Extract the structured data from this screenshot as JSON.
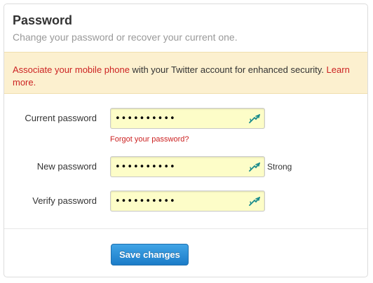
{
  "header": {
    "title": "Password",
    "subtitle": "Change your password or recover your current one."
  },
  "alert": {
    "link_text": "Associate your mobile phone",
    "text": " with your Twitter account for enhanced security. ",
    "learn_more": "Learn more."
  },
  "form": {
    "current": {
      "label": "Current password",
      "value": "••••••••••",
      "forgot_link": "Forgot your password?"
    },
    "new": {
      "label": "New password",
      "value": "••••••••••",
      "strength": "Strong"
    },
    "verify": {
      "label": "Verify password",
      "value": "••••••••••"
    },
    "save_label": "Save changes"
  },
  "colors": {
    "link": "#cc2222",
    "alert_bg": "#fcf0cf",
    "field_bg": "#fdfdc8",
    "button": "#1b7cc8",
    "key_icon": "#1a8c8c"
  },
  "icons": {
    "password_field": "key-icon"
  }
}
